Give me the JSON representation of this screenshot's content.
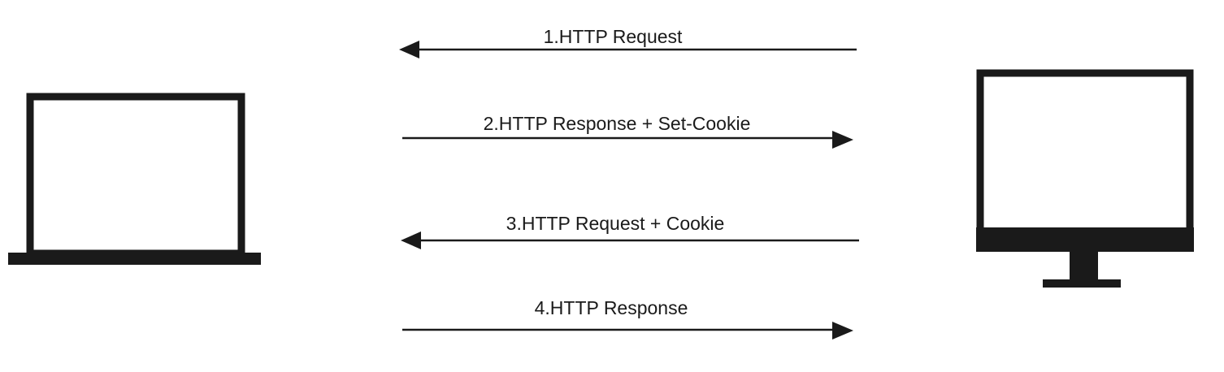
{
  "colors": {
    "ink": "#1a1a1a",
    "background": "#ffffff"
  },
  "client": {
    "icon": "laptop-icon"
  },
  "server": {
    "icon": "desktop-monitor-icon"
  },
  "messages": [
    {
      "step": 1,
      "label": "1.HTTP Request",
      "direction": "to-client"
    },
    {
      "step": 2,
      "label": "2.HTTP Response + Set-Cookie",
      "direction": "to-server"
    },
    {
      "step": 3,
      "label": "3.HTTP Request + Cookie",
      "direction": "to-client"
    },
    {
      "step": 4,
      "label": "4.HTTP Response",
      "direction": "to-server"
    }
  ]
}
